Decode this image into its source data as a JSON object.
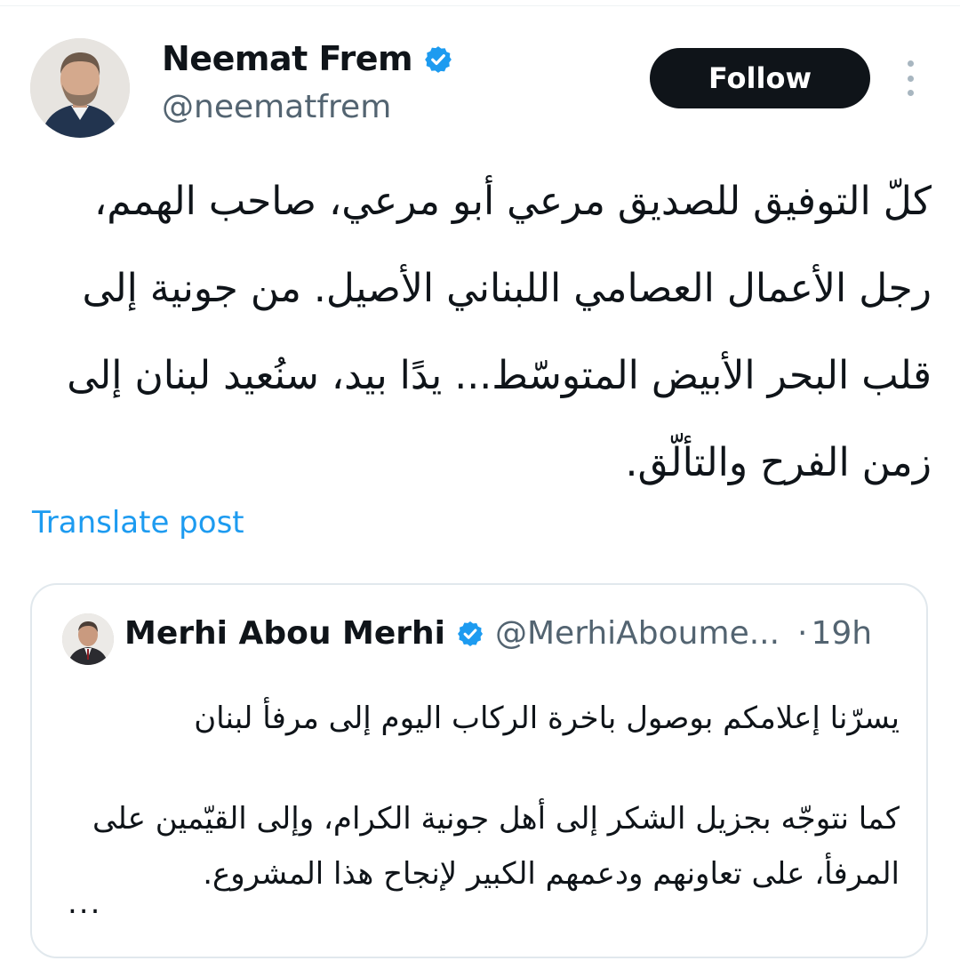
{
  "post": {
    "author": {
      "name": "Neemat Frem",
      "handle": "@neematfrem",
      "verified": true
    },
    "follow_label": "Follow",
    "text": "كلّ التوفيق للصديق مرعي أبو مرعي، صاحب الهمم، رجل الأعمال العصامي اللبناني الأصيل. من جونية إلى قلب البحر الأبيض المتوسّط... يدًا بيد، سنُعيد لبنان إلى زمن الفرح والتألّق.",
    "translate_label": "Translate post"
  },
  "quoted_post": {
    "author": {
      "name": "Merhi Abou Merhi",
      "handle": "@MerhiAboume...",
      "verified": true
    },
    "separator": "·",
    "time": "19h",
    "line1": "يسرّنا إعلامكم بوصول باخرة الركاب اليوم إلى مرفأ لبنان",
    "line2": "كما نتوجّه بجزيل الشكر إلى أهل جونية الكرام، وإلى القيّمين على المرفأ، على تعاونهم ودعمهم الكبير لإنجاح هذا المشروع.",
    "truncation": "..."
  },
  "icons": {
    "verified": "verified-badge-icon",
    "more": "more-vertical-icon"
  },
  "colors": {
    "verified_blue": "#1d9bf0",
    "link_blue": "#1d9bf0",
    "secondary_text": "#536471",
    "follow_bg": "#0f1419"
  }
}
